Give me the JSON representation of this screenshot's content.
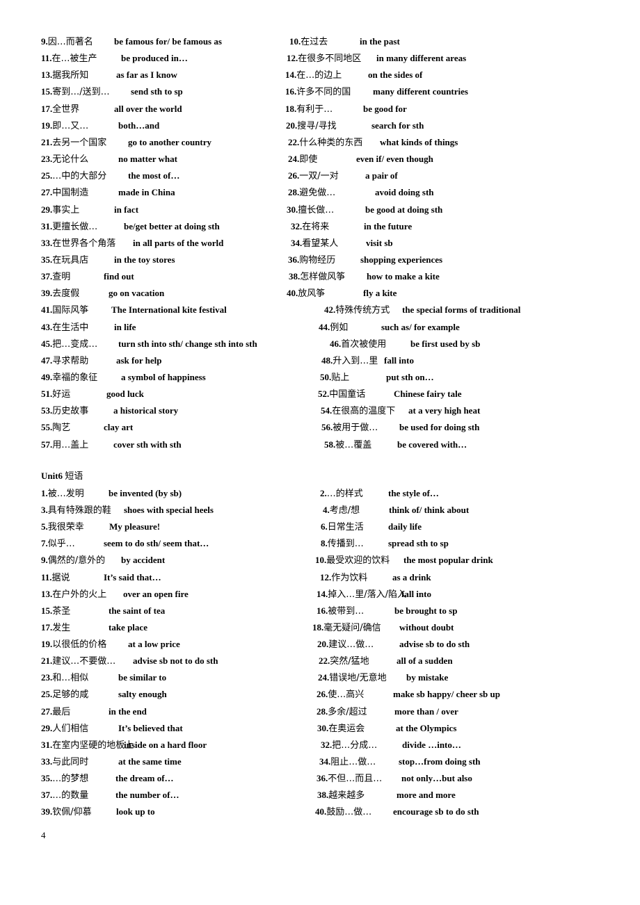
{
  "section1": {
    "rows": [
      {
        "left": {
          "num": "9.",
          "cn": "因…而著名",
          "en": "be famous for/ be famous as"
        },
        "right": {
          "num": "10.",
          "cn": "在过去",
          "en": "in the past"
        }
      },
      {
        "left": {
          "num": "11.",
          "cn": "在…被生产",
          "en": "be produced in…"
        },
        "right": {
          "num": "12.",
          "cn": "在很多不同地区",
          "en": "in many different areas"
        }
      },
      {
        "left": {
          "num": "13.",
          "cn": "据我所知",
          "en": "as far as I know"
        },
        "right": {
          "num": "14.",
          "cn": "在…的边上",
          "en": "on the sides of"
        }
      },
      {
        "left": {
          "num": "15.",
          "cn": "寄到…/送到…",
          "en": "send sth to sp"
        },
        "right": {
          "num": "16.",
          "cn": "许多不同的国",
          "en": "many different countries"
        }
      },
      {
        "left": {
          "num": "17.",
          "cn": "全世界",
          "en": "all over the world"
        },
        "right": {
          "num": "18.",
          "cn": "有利于…",
          "en": "be good for"
        }
      },
      {
        "left": {
          "num": "19.",
          "cn": "即…又…",
          "en": "both…and"
        },
        "right": {
          "num": "20.",
          "cn": "搜寻/寻找",
          "en": "search for sth"
        }
      },
      {
        "left": {
          "num": "21.",
          "cn": "去另一个国家",
          "en": "go to another country"
        },
        "right": {
          "num": "22.",
          "cn": "什么种类的东西",
          "en": "what kinds of things"
        }
      },
      {
        "left": {
          "num": "23.",
          "cn": "无论什么",
          "en": "no matter what"
        },
        "right": {
          "num": "24.",
          "cn": "即使",
          "en": "even if/ even though"
        }
      },
      {
        "left": {
          "num": "25.",
          "cn": "…中的大部分",
          "en": "the most of…"
        },
        "right": {
          "num": "26.",
          "cn": "一双/一对",
          "en": "a pair of"
        }
      },
      {
        "left": {
          "num": "27.",
          "cn": "中国制造",
          "en": "made in China"
        },
        "right": {
          "num": "28.",
          "cn": "避免做…",
          "en": "avoid doing sth"
        }
      },
      {
        "left": {
          "num": "29.",
          "cn": "事实上",
          "en": "in fact"
        },
        "right": {
          "num": "30.",
          "cn": "擅长做…",
          "en": "be good at doing sth"
        }
      },
      {
        "left": {
          "num": "31.",
          "cn": "更擅长做…",
          "en": "be/get better at doing sth"
        },
        "right": {
          "num": "32.",
          "cn": "在将来",
          "en": "in the future"
        }
      },
      {
        "left": {
          "num": "33.",
          "cn": "在世界各个角落",
          "en": "in all parts of the world"
        },
        "right": {
          "num": "34.",
          "cn": "看望某人",
          "en": "visit sb"
        }
      },
      {
        "left": {
          "num": "35.",
          "cn": "在玩具店",
          "en": "in the toy stores"
        },
        "right": {
          "num": "36.",
          "cn": "购物经历",
          "en": "shopping experiences"
        }
      },
      {
        "left": {
          "num": "37.",
          "cn": "查明",
          "en": "find out"
        },
        "right": {
          "num": "38.",
          "cn": "怎样做风筝",
          "en": "how to make a kite"
        }
      },
      {
        "left": {
          "num": "39.",
          "cn": "去度假",
          "en": "go on vacation"
        },
        "right": {
          "num": "40.",
          "cn": "放风筝",
          "en": "fly a kite"
        }
      },
      {
        "left": {
          "num": "41.",
          "cn": "国际风筝",
          "en": "The International kite festival"
        },
        "right": {
          "num": "42.",
          "cn": "特殊传统方式",
          "en": "the special forms of traditional"
        }
      },
      {
        "left": {
          "num": "43.",
          "cn": "在生活中",
          "en": "in life"
        },
        "right": {
          "num": "44.",
          "cn": "例如",
          "en": "such as/ for example"
        }
      },
      {
        "left": {
          "num": "45.",
          "cn": "把…变成…",
          "en": "turn sth into sth/  change sth into sth"
        },
        "right": {
          "num": "46.",
          "cn": "首次被使用",
          "en": "be first used by sb"
        }
      },
      {
        "left": {
          "num": "47.",
          "cn": "寻求帮助",
          "en": "ask for help"
        },
        "right": {
          "num": "48.",
          "cn": "升入到…里",
          "en": "fall into"
        }
      },
      {
        "left": {
          "num": "49.",
          "cn": "幸福的象征",
          "en": "a symbol of happiness"
        },
        "right": {
          "num": "50.",
          "cn": "贴上",
          "en": "put sth on…"
        }
      },
      {
        "left": {
          "num": "51.",
          "cn": "好运",
          "en": "good luck"
        },
        "right": {
          "num": "52.",
          "cn": "中国童话",
          "en": "Chinese fairy tale"
        }
      },
      {
        "left": {
          "num": "53.",
          "cn": "历史故事",
          "en": "a historical story"
        },
        "right": {
          "num": "54.",
          "cn": "在很高的温度下",
          "en": "at a very high heat"
        }
      },
      {
        "left": {
          "num": "55.",
          "cn": "陶艺",
          "en": "clay art"
        },
        "right": {
          "num": "56.",
          "cn": "被用于做…",
          "en": "be used for doing sth"
        }
      },
      {
        "left": {
          "num": "57.",
          "cn": "用…盖上",
          "en": "cover sth with sth"
        },
        "right": {
          "num": "58.",
          "cn": "被…覆盖",
          "en": "be covered with…"
        }
      }
    ]
  },
  "section2": {
    "heading_en": "Unit6",
    "heading_cn": "短语",
    "rows": [
      {
        "left": {
          "num": "1.",
          "cn": "被…发明",
          "en": "be invented (by sb)"
        },
        "right": {
          "num": "2.",
          "cn": "…的样式",
          "en": "the style of…"
        }
      },
      {
        "left": {
          "num": "3.",
          "cn": "具有特殊跟的鞋",
          "en": "shoes with special heels"
        },
        "right": {
          "num": "4.",
          "cn": "考虑/想",
          "en": "think of/ think about"
        }
      },
      {
        "left": {
          "num": "5.",
          "cn": "我很荣幸",
          "en": "My pleasure!"
        },
        "right": {
          "num": "6.",
          "cn": "日常生活",
          "en": "daily life"
        }
      },
      {
        "left": {
          "num": "7.",
          "cn": "似乎…",
          "en": "seem to do sth/ seem that…"
        },
        "right": {
          "num": "8.",
          "cn": "传播到…",
          "en": "spread sth to sp"
        }
      },
      {
        "left": {
          "num": "9.",
          "cn": "偶然的/意外的",
          "en": "by accident"
        },
        "right": {
          "num": "10.",
          "cn": "最受欢迎的饮料",
          "en": "the most popular drink"
        }
      },
      {
        "left": {
          "num": "11.",
          "cn": "据说",
          "en": "It’s said that…"
        },
        "right": {
          "num": "12.",
          "cn": "作为饮料",
          "en": "as a drink"
        }
      },
      {
        "left": {
          "num": "13.",
          "cn": "在户外的火上",
          "en": "over an open fire"
        },
        "right": {
          "num": "14.",
          "cn": "掉入…里/落入/陷入",
          "en": "fall into"
        }
      },
      {
        "left": {
          "num": "15.",
          "cn": "茶圣",
          "en": "the saint of tea"
        },
        "right": {
          "num": "16.",
          "cn": "被带到…",
          "en": "be brought to sp"
        }
      },
      {
        "left": {
          "num": "17.",
          "cn": "发生",
          "en": "take place"
        },
        "right": {
          "num": "18.",
          "cn": "毫无疑问/确信",
          "en": "without doubt"
        }
      },
      {
        "left": {
          "num": "19.",
          "cn": "以很低的价格",
          "en": "at a low price"
        },
        "right": {
          "num": "20.",
          "cn": "建议…做…",
          "en": "advise sb to do sth"
        }
      },
      {
        "left": {
          "num": "21.",
          "cn": "建议…不要做…",
          "en": "advise sb not to do sth"
        },
        "right": {
          "num": "22.",
          "cn": "突然/猛地",
          "en": "all of a sudden"
        }
      },
      {
        "left": {
          "num": "23.",
          "cn": "和…相似",
          "en": "be similar to"
        },
        "right": {
          "num": "24.",
          "cn": "错误地/无意地",
          "en": "by mistake"
        }
      },
      {
        "left": {
          "num": "25.",
          "cn": "足够的咸",
          "en": "salty enough"
        },
        "right": {
          "num": "26.",
          "cn": "使…高兴",
          "en": "make sb happy/ cheer sb up"
        }
      },
      {
        "left": {
          "num": "27.",
          "cn": "最后",
          "en": "in the end"
        },
        "right": {
          "num": "28.",
          "cn": "多余/超过",
          "en": "more than / over"
        }
      },
      {
        "left": {
          "num": "29.",
          "cn": "人们相信",
          "en": "It’s believed that"
        },
        "right": {
          "num": "30.",
          "cn": "在奥运会",
          "en": "at the Olympics"
        }
      },
      {
        "left": {
          "num": "31.",
          "cn": "在室内坚硬的地板上",
          "en": "inside on a hard floor"
        },
        "right": {
          "num": "32.",
          "cn": "把…分成…",
          "en": "divide …into…"
        }
      },
      {
        "left": {
          "num": "33.",
          "cn": "与此同时",
          "en": "at the same time"
        },
        "right": {
          "num": "34.",
          "cn": "阻止…做…",
          "en": "stop…from doing sth"
        }
      },
      {
        "left": {
          "num": "35.",
          "cn": "…的梦想",
          "en": "the dream of…"
        },
        "right": {
          "num": "36.",
          "cn": "不但…而且…",
          "en": "not only…but also"
        }
      },
      {
        "left": {
          "num": "37.",
          "cn": "…的数量",
          "en": "the number of…"
        },
        "right": {
          "num": "38.",
          "cn": "越来越多",
          "en": "more and more"
        }
      },
      {
        "left": {
          "num": "39.",
          "cn": "钦佩/仰慕",
          "en": "look up to"
        },
        "right": {
          "num": "40.",
          "cn": "鼓励…做…",
          "en": "encourage sb to do sth"
        }
      }
    ]
  },
  "footer": {
    "page_number": "4"
  }
}
